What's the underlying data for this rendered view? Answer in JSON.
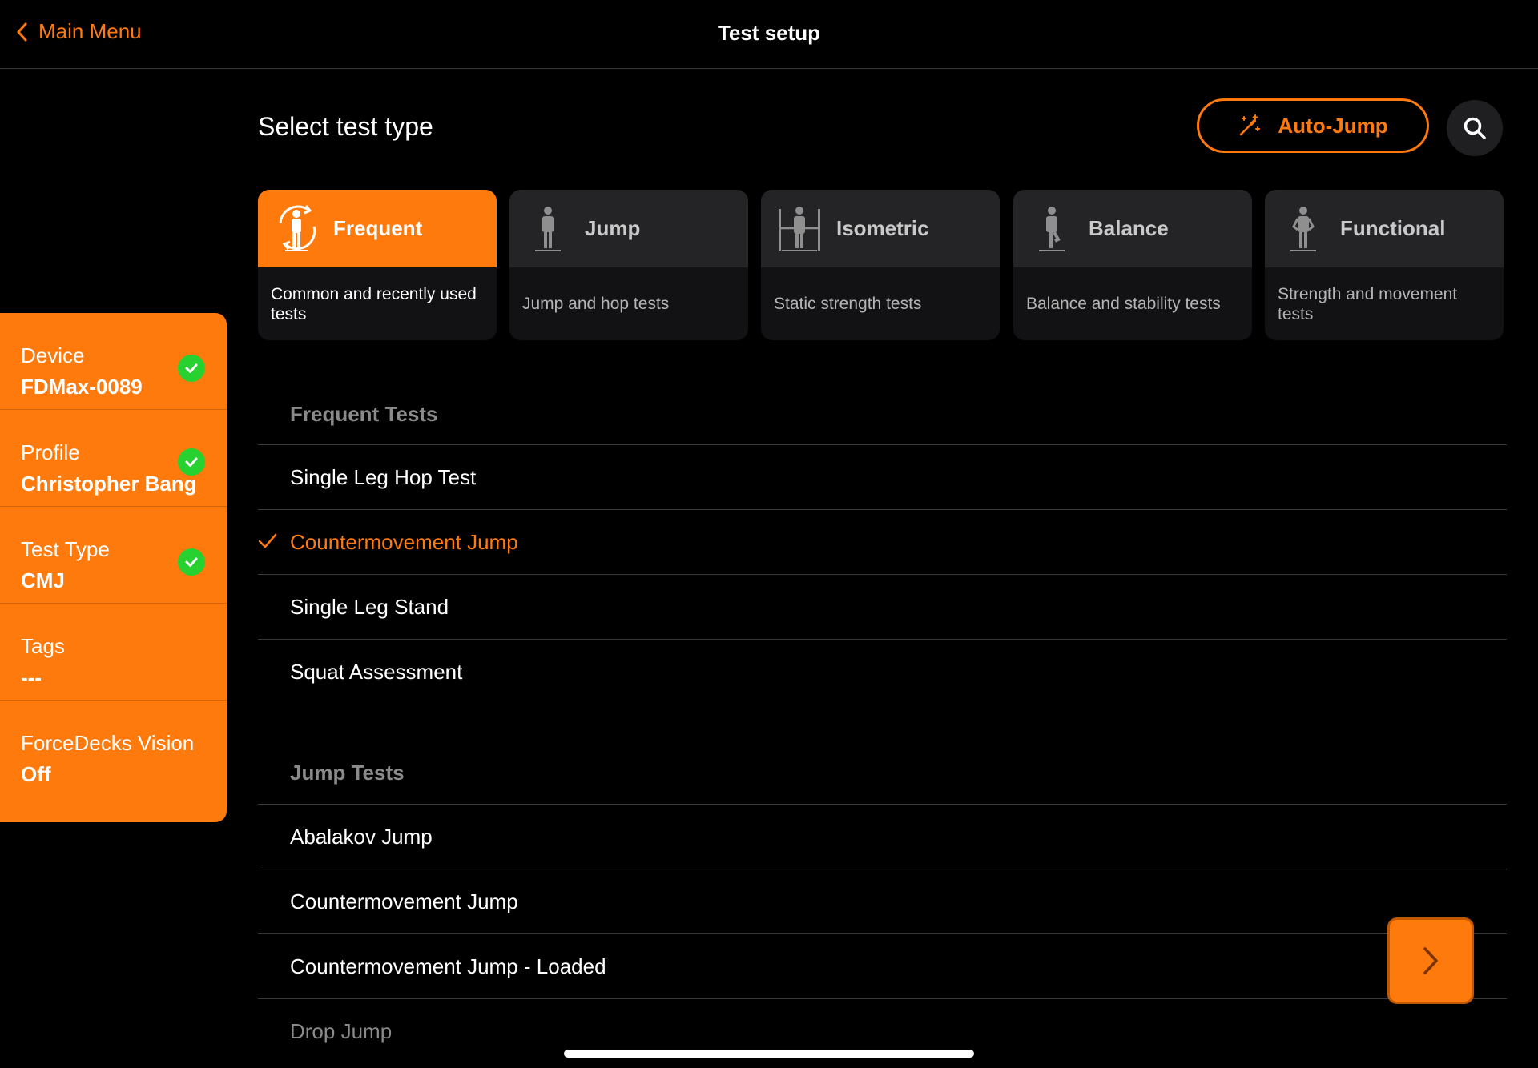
{
  "header": {
    "back_label": "Main Menu",
    "title": "Test setup"
  },
  "main": {
    "section_title": "Select test type",
    "auto_jump_label": "Auto-Jump"
  },
  "categories": [
    {
      "label": "Frequent",
      "description": "Common and recently used tests",
      "active": true
    },
    {
      "label": "Jump",
      "description": "Jump and hop tests",
      "active": false
    },
    {
      "label": "Isometric",
      "description": "Static strength tests",
      "active": false
    },
    {
      "label": "Balance",
      "description": "Balance and stability tests",
      "active": false
    },
    {
      "label": "Functional",
      "description": "Strength and movement tests",
      "active": false
    }
  ],
  "sidebar": {
    "items": [
      {
        "label": "Device",
        "value": "FDMax-0089",
        "checked": true
      },
      {
        "label": "Profile",
        "value": "Christopher Bang",
        "checked": true
      },
      {
        "label": "Test Type",
        "value": "CMJ",
        "checked": true
      },
      {
        "label": "Tags",
        "value": "---",
        "checked": false
      },
      {
        "label": "ForceDecks Vision",
        "value": "Off",
        "checked": false
      }
    ]
  },
  "list": {
    "groups": [
      {
        "title": "Frequent Tests",
        "items": [
          {
            "label": "Single Leg Hop Test",
            "selected": false
          },
          {
            "label": "Countermovement Jump",
            "selected": true
          },
          {
            "label": "Single Leg Stand",
            "selected": false
          },
          {
            "label": "Squat Assessment",
            "selected": false
          }
        ]
      },
      {
        "title": "Jump Tests",
        "items": [
          {
            "label": "Abalakov Jump",
            "selected": false
          },
          {
            "label": "Countermovement Jump",
            "selected": false
          },
          {
            "label": "Countermovement Jump - Loaded",
            "selected": false
          },
          {
            "label": "Drop Jump",
            "selected": false
          }
        ]
      }
    ]
  },
  "colors": {
    "accent": "#ff7a0c",
    "background": "#000000",
    "card": "#242426",
    "check": "#26d130"
  }
}
